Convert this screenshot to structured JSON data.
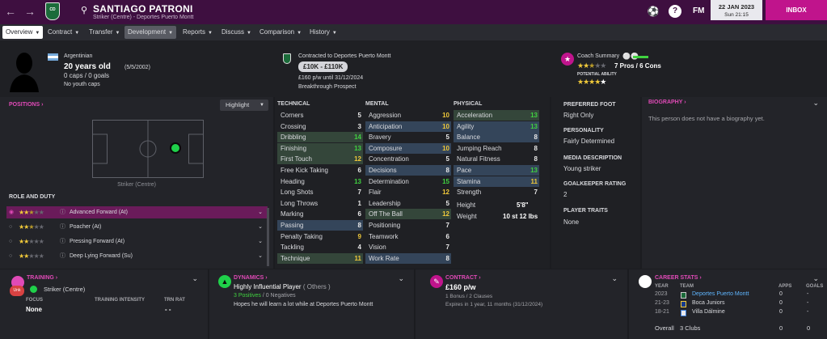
{
  "topbar": {
    "back_icon": "arrow-left-icon",
    "forward_icon": "arrow-right-icon",
    "club_badge_text": "CD",
    "player_name": "SANTIAGO PATRONI",
    "player_subtitle": "Striker (Centre) - Deportes Puerto Montt",
    "fm_label": "FM",
    "date": "22 JAN 2023",
    "time": "Sun 21:15",
    "inbox_label": "INBOX"
  },
  "tabs": [
    {
      "label": "Overview"
    },
    {
      "label": "Contract"
    },
    {
      "label": "Transfer"
    },
    {
      "label": "Development"
    },
    {
      "label": "Reports"
    },
    {
      "label": "Discuss"
    },
    {
      "label": "Comparison"
    },
    {
      "label": "History"
    }
  ],
  "header": {
    "nationality": "Argentinian",
    "age": "20 years old",
    "dob": "(5/5/2002)",
    "caps": "0 caps / 0 goals",
    "youth_caps": "No youth caps",
    "contract_line": "Contracted to Deportes Puerto Montt",
    "value_range": "£10K - £110K",
    "wage": "£160 p/w until 31/12/2024",
    "prospect": "Breakthrough Prospect",
    "coach_summary_label": "Coach Summary",
    "pros_cons": "7 Pros / 6 Cons",
    "potential_label": "POTENTIAL ABILITY",
    "current_ability_stars": 2.5,
    "potential_ability_stars": 4.5
  },
  "positions": {
    "title": "POSITIONS",
    "highlight_label": "Highlight",
    "position_label": "Striker (Centre)",
    "role_title": "ROLE AND DUTY",
    "roles": [
      {
        "name": "Advanced Forward (At)",
        "stars": 2.5,
        "selected": true
      },
      {
        "name": "Poacher (At)",
        "stars": 2.5,
        "selected": false
      },
      {
        "name": "Pressing Forward (At)",
        "stars": 2,
        "selected": false
      },
      {
        "name": "Deep Lying Forward (Su)",
        "stars": 2,
        "selected": false
      }
    ]
  },
  "technical": {
    "title": "TECHNICAL",
    "rows": [
      {
        "label": "Corners",
        "value": "5"
      },
      {
        "label": "Crossing",
        "value": "3"
      },
      {
        "label": "Dribbling",
        "value": "14"
      },
      {
        "label": "Finishing",
        "value": "13"
      },
      {
        "label": "First Touch",
        "value": "12"
      },
      {
        "label": "Free Kick Taking",
        "value": "6"
      },
      {
        "label": "Heading",
        "value": "13"
      },
      {
        "label": "Long Shots",
        "value": "7"
      },
      {
        "label": "Long Throws",
        "value": "1"
      },
      {
        "label": "Marking",
        "value": "6"
      },
      {
        "label": "Passing",
        "value": "8"
      },
      {
        "label": "Penalty Taking",
        "value": "9"
      },
      {
        "label": "Tackling",
        "value": "4"
      },
      {
        "label": "Technique",
        "value": "11"
      }
    ]
  },
  "mental": {
    "title": "MENTAL",
    "rows": [
      {
        "label": "Aggression",
        "value": "10"
      },
      {
        "label": "Anticipation",
        "value": "10"
      },
      {
        "label": "Bravery",
        "value": "5"
      },
      {
        "label": "Composure",
        "value": "10"
      },
      {
        "label": "Concentration",
        "value": "5"
      },
      {
        "label": "Decisions",
        "value": "8"
      },
      {
        "label": "Determination",
        "value": "15"
      },
      {
        "label": "Flair",
        "value": "12"
      },
      {
        "label": "Leadership",
        "value": "5"
      },
      {
        "label": "Off The Ball",
        "value": "12"
      },
      {
        "label": "Positioning",
        "value": "7"
      },
      {
        "label": "Teamwork",
        "value": "6"
      },
      {
        "label": "Vision",
        "value": "7"
      },
      {
        "label": "Work Rate",
        "value": "8"
      }
    ]
  },
  "physical": {
    "title": "PHYSICAL",
    "rows": [
      {
        "label": "Acceleration",
        "value": "13"
      },
      {
        "label": "Agility",
        "value": "13"
      },
      {
        "label": "Balance",
        "value": "8"
      },
      {
        "label": "Jumping Reach",
        "value": "8"
      },
      {
        "label": "Natural Fitness",
        "value": "8"
      },
      {
        "label": "Pace",
        "value": "13"
      },
      {
        "label": "Stamina",
        "value": "11"
      },
      {
        "label": "Strength",
        "value": "7"
      }
    ],
    "height_label": "Height",
    "height_value": "5'8\"",
    "weight_label": "Weight",
    "weight_value": "10 st 12 lbs"
  },
  "info": {
    "preferred_foot_label": "PREFERRED FOOT",
    "preferred_foot": "Right Only",
    "personality_label": "PERSONALITY",
    "personality": "Fairly Determined",
    "media_label": "MEDIA DESCRIPTION",
    "media": "Young striker",
    "gk_label": "GOALKEEPER RATING",
    "gk": "2",
    "traits_label": "PLAYER TRAITS",
    "traits": "None"
  },
  "biography": {
    "title": "BIOGRAPHY",
    "text": "This person does not have a biography yet."
  },
  "training": {
    "title": "TRAINING",
    "position": "Striker (Centre)",
    "focus_label": "FOCUS",
    "focus": "None",
    "intensity_label": "TRAINING INTENSITY",
    "trn_rat_label": "TRN RAT",
    "trn_rat": "- -",
    "badge_text": "Unk"
  },
  "dynamics": {
    "title": "DYNAMICS",
    "influence": "Highly Influential Player",
    "influence_note": "( Others )",
    "positives": "3 Positives",
    "negatives": "0 Negatives",
    "quote": "Hopes he will learn a lot while at Deportes Puerto Montt"
  },
  "contract": {
    "title": "CONTRACT",
    "wage": "£160 p/w",
    "bonuses": "1 Bonus / 2 Clauses",
    "expires": "Expires in 1 year, 11 months (31/12/2024)"
  },
  "career": {
    "title": "CAREER STATS",
    "col_year": "YEAR",
    "col_team": "TEAM",
    "col_apps": "APPS",
    "col_goals": "GOALS",
    "rows": [
      {
        "year": "2023",
        "team": "Deportes Puerto Montt",
        "apps": "0",
        "goals": "-"
      },
      {
        "year": "21-23",
        "team": "Boca Juniors",
        "apps": "0",
        "goals": "-"
      },
      {
        "year": "18-21",
        "team": "Villa Dálmine",
        "apps": "0",
        "goals": "-"
      }
    ],
    "overall_label": "Overall",
    "overall_clubs": "3 Clubs",
    "overall_apps": "0",
    "overall_goals": "0"
  },
  "colors": {
    "topbar": "#3e0f40",
    "accent_pink": "#e04ab7",
    "inbox": "#c0148c",
    "attr_green": "#40d240",
    "attr_yellow": "#f0c93a"
  }
}
